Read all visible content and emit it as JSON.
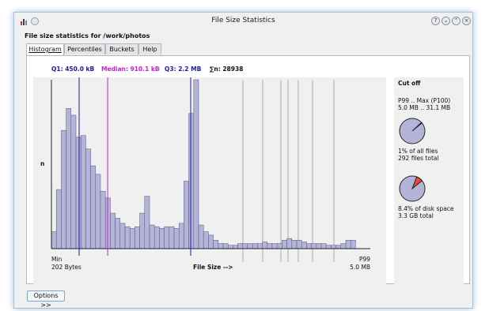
{
  "window": {
    "title": "File Size Statistics"
  },
  "heading": "File size statistics for /work/photos",
  "tabs": [
    {
      "label": "Histogram",
      "active": true
    },
    {
      "label": "Percentiles",
      "active": false
    },
    {
      "label": "Buckets",
      "active": false
    },
    {
      "label": "Help",
      "active": false
    }
  ],
  "stats": {
    "q1": "Q1: 450.0 kB",
    "median": "Median: 910.1 kB",
    "q3": "Q3: 2.2 MB",
    "n": "∑n: 28938"
  },
  "colors": {
    "q1": "#1a1aa6",
    "median": "#cc22cc",
    "q3": "#1a1aa6",
    "bars": "#b4b4d8",
    "cutoff_lines": "#9a9a9a"
  },
  "chart_data": {
    "type": "bar",
    "ylabel": "n",
    "xlabel": "File Size  -->",
    "x_min_label": "Min",
    "x_min_value": "202 Bytes",
    "x_max_label": "P99",
    "x_max_value": "5.0 MB",
    "values": [
      10,
      35,
      70,
      83,
      79,
      66,
      67,
      59,
      49,
      44,
      34,
      30,
      21,
      18,
      15,
      13,
      12,
      13,
      21,
      31,
      14,
      13,
      12,
      13,
      13,
      12,
      15,
      40,
      80,
      100,
      14,
      10,
      8,
      5,
      3,
      3,
      2,
      2,
      3,
      3,
      3,
      3,
      3,
      4,
      3,
      3,
      3,
      5,
      6,
      5,
      5,
      4,
      3,
      3,
      3,
      3,
      2,
      2,
      2,
      3,
      5,
      5
    ]
  },
  "cutoff": {
    "title": "Cut off",
    "range_label": "P99 .. Max (P100)",
    "range_value": "5.0 MB .. 31.1 MB",
    "files_pct": "1% of all files",
    "files_total": "292 files total",
    "files_fraction": 0.01,
    "space_pct": "8.4% of disk space",
    "space_total": "3.3 GB total",
    "space_fraction": 0.084
  },
  "options_button": "Options >>"
}
